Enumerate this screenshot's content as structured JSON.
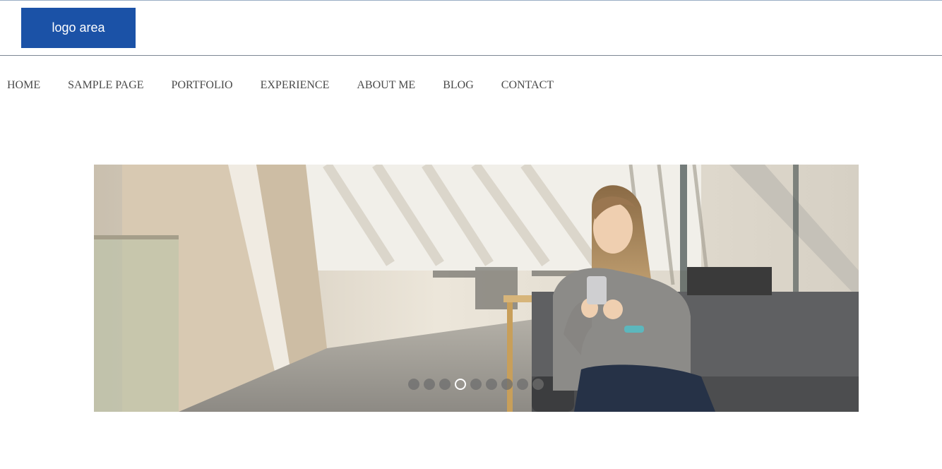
{
  "header": {
    "logo_text": "logo area"
  },
  "nav": {
    "items": [
      "HOME",
      "SAMPLE PAGE",
      "PORTFOLIO",
      "EXPERIENCE",
      "ABOUT ME",
      "BLOG",
      "CONTACT"
    ]
  },
  "slider": {
    "image_description": "woman smiling at phone in bright office lounge",
    "slide_count": 9,
    "active_slide": 4
  },
  "colors": {
    "logo_bg": "#1b52a7",
    "nav_text": "#4a4a4a",
    "header_rule": "#7d8794"
  }
}
